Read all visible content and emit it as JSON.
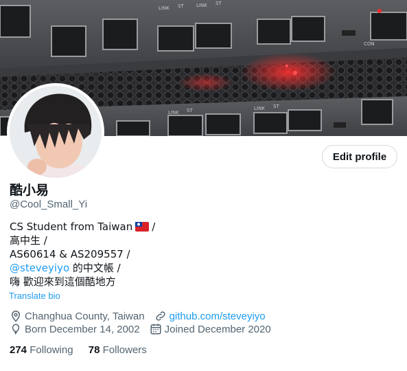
{
  "profile": {
    "display_name": "酷小易",
    "handle": "@Cool_Small_Yi",
    "edit_button": "Edit profile"
  },
  "bio": {
    "line1": "CS Student from Taiwan",
    "line1_suffix": "/",
    "line2": "高中生 /",
    "line3": "AS60614 & AS209557 /",
    "line4_link": "@steveyiyo",
    "line4_rest": " 的中文帳 /",
    "line5": "嗨 歡迎來到這個酷地方",
    "translate_label": "Translate bio"
  },
  "meta": {
    "location": "Changhua County, Taiwan",
    "website": "github.com/steveyiyo",
    "birthday": "Born December 14, 2002",
    "joined": "Joined December 2020"
  },
  "counts": {
    "following_count": "274",
    "following_label": "Following",
    "followers_count": "78",
    "followers_label": "Followers"
  },
  "banner": {
    "port_labels": [
      "LINK",
      "ST",
      "LINK",
      "ST",
      "LINK",
      "ST",
      "LINK",
      "ST",
      "CON"
    ]
  },
  "colors": {
    "accent": "#1d9bf0",
    "secondary_text": "#536471",
    "led_red": "#ff2a2a"
  },
  "icons": [
    "location-icon",
    "link-icon",
    "balloon-icon",
    "calendar-icon",
    "taiwan-flag-icon"
  ]
}
